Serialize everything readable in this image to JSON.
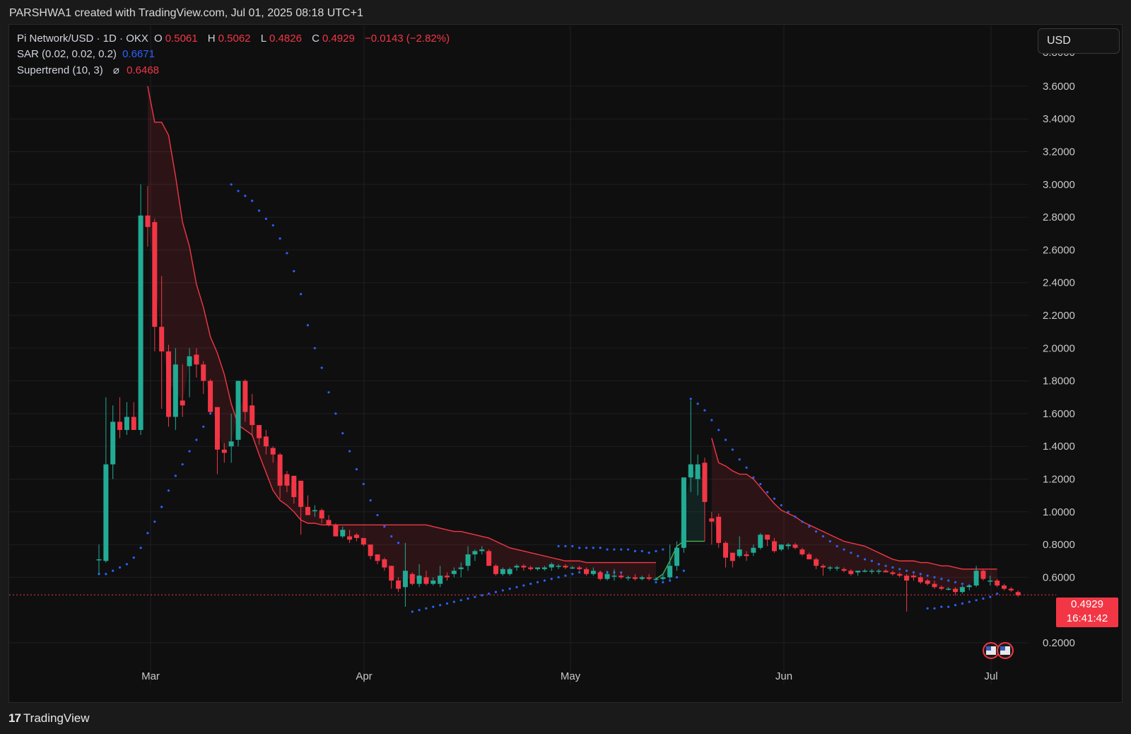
{
  "credit": "PARSHWA1 created with TradingView.com, Jul 01, 2025 08:18 UTC+1",
  "legend": {
    "symbol": "Pi Network/USD · 1D · OKX",
    "o_label": "O",
    "o": "0.5061",
    "h_label": "H",
    "h": "0.5062",
    "l_label": "L",
    "l": "0.4826",
    "c_label": "C",
    "c": "0.4929",
    "change": "−0.0143 (−2.82%)",
    "sar_label": "SAR (0.02, 0.02, 0.2)",
    "sar": "0.6671",
    "st_label": "Supertrend (10, 3)",
    "st_symbol": "⌀",
    "st": "0.6468"
  },
  "currency_button": "USD",
  "last_price": "0.4929",
  "countdown": "16:41:42",
  "footer_brand": "TradingView",
  "footer_logo": "17",
  "colors": {
    "up": "#22ab94",
    "down": "#f23645",
    "sar": "#2962ff",
    "bg": "#0f0f10"
  },
  "chart_data": {
    "type": "candlestick",
    "y_ticks": [
      "0.2000",
      "0.6000",
      "0.8000",
      "1.0000",
      "1.2000",
      "1.4000",
      "1.6000",
      "1.8000",
      "2.0000",
      "2.2000",
      "2.4000",
      "2.6000",
      "2.8000",
      "3.0000",
      "3.2000",
      "3.4000",
      "3.6000"
    ],
    "x_ticks": [
      "Mar",
      "Apr",
      "May",
      "Jun",
      "Jul"
    ],
    "ylim": [
      0.14,
      3.83
    ],
    "x_start": "2025-02-20",
    "candles": [
      [
        0.71,
        0.8,
        0.62,
        0.71
      ],
      [
        0.7,
        1.7,
        0.69,
        1.29
      ],
      [
        1.29,
        1.65,
        1.2,
        1.55
      ],
      [
        1.55,
        1.7,
        1.45,
        1.5
      ],
      [
        1.5,
        1.67,
        1.47,
        1.58
      ],
      [
        1.58,
        1.67,
        1.5,
        1.5
      ],
      [
        1.5,
        3.0,
        1.47,
        2.81
      ],
      [
        2.81,
        2.99,
        2.62,
        2.74
      ],
      [
        2.77,
        2.79,
        1.98,
        2.13
      ],
      [
        2.13,
        2.44,
        1.63,
        1.98
      ],
      [
        1.98,
        2.02,
        1.52,
        1.58
      ],
      [
        1.58,
        2.0,
        1.5,
        1.9
      ],
      [
        1.68,
        1.9,
        1.58,
        1.65
      ],
      [
        1.89,
        2.0,
        1.7,
        1.95
      ],
      [
        1.96,
        2.0,
        1.82,
        1.9
      ],
      [
        1.9,
        1.92,
        1.72,
        1.8
      ],
      [
        1.8,
        1.81,
        1.6,
        1.61
      ],
      [
        1.64,
        1.64,
        1.23,
        1.38
      ],
      [
        1.38,
        1.42,
        1.3,
        1.36
      ],
      [
        1.4,
        1.6,
        1.3,
        1.43
      ],
      [
        1.44,
        1.8,
        1.4,
        1.8
      ],
      [
        1.8,
        1.81,
        1.55,
        1.61
      ],
      [
        1.65,
        1.72,
        1.46,
        1.53
      ],
      [
        1.53,
        1.53,
        1.41,
        1.45
      ],
      [
        1.46,
        1.5,
        1.35,
        1.4
      ],
      [
        1.39,
        1.4,
        1.3,
        1.35
      ],
      [
        1.35,
        1.36,
        1.08,
        1.16
      ],
      [
        1.23,
        1.25,
        1.12,
        1.16
      ],
      [
        1.22,
        1.22,
        1.05,
        1.09
      ],
      [
        1.19,
        1.19,
        0.86,
        1.03
      ],
      [
        1.03,
        1.1,
        0.98,
        0.98
      ],
      [
        1.01,
        1.04,
        0.97,
        1.01
      ],
      [
        1.01,
        1.02,
        0.93,
        0.96
      ],
      [
        0.95,
        0.98,
        0.91,
        0.92
      ],
      [
        0.92,
        0.93,
        0.85,
        0.85
      ],
      [
        0.85,
        0.91,
        0.84,
        0.89
      ],
      [
        0.85,
        0.89,
        0.81,
        0.83
      ],
      [
        0.86,
        0.87,
        0.82,
        0.84
      ],
      [
        0.84,
        0.84,
        0.79,
        0.8
      ],
      [
        0.8,
        0.8,
        0.71,
        0.73
      ],
      [
        0.74,
        0.74,
        0.68,
        0.7
      ],
      [
        0.71,
        0.72,
        0.64,
        0.66
      ],
      [
        0.67,
        0.67,
        0.53,
        0.58
      ],
      [
        0.58,
        0.6,
        0.51,
        0.53
      ],
      [
        0.54,
        0.81,
        0.42,
        0.64
      ],
      [
        0.62,
        0.63,
        0.55,
        0.56
      ],
      [
        0.56,
        0.68,
        0.54,
        0.61
      ],
      [
        0.6,
        0.64,
        0.55,
        0.56
      ],
      [
        0.56,
        0.6,
        0.55,
        0.58
      ],
      [
        0.56,
        0.67,
        0.54,
        0.61
      ],
      [
        0.61,
        0.63,
        0.58,
        0.6
      ],
      [
        0.62,
        0.66,
        0.6,
        0.64
      ],
      [
        0.65,
        0.69,
        0.6,
        0.66
      ],
      [
        0.67,
        0.79,
        0.64,
        0.74
      ],
      [
        0.74,
        0.77,
        0.7,
        0.76
      ],
      [
        0.76,
        0.79,
        0.74,
        0.77
      ],
      [
        0.76,
        0.77,
        0.67,
        0.67
      ],
      [
        0.67,
        0.68,
        0.61,
        0.62
      ],
      [
        0.62,
        0.66,
        0.61,
        0.65
      ],
      [
        0.62,
        0.66,
        0.61,
        0.65
      ],
      [
        0.66,
        0.68,
        0.64,
        0.67
      ],
      [
        0.67,
        0.68,
        0.64,
        0.66
      ],
      [
        0.66,
        0.67,
        0.64,
        0.65
      ],
      [
        0.65,
        0.66,
        0.64,
        0.66
      ],
      [
        0.65,
        0.67,
        0.64,
        0.66
      ],
      [
        0.66,
        0.69,
        0.64,
        0.68
      ],
      [
        0.67,
        0.68,
        0.65,
        0.67
      ],
      [
        0.67,
        0.68,
        0.65,
        0.66
      ],
      [
        0.66,
        0.67,
        0.65,
        0.66
      ],
      [
        0.66,
        0.67,
        0.64,
        0.65
      ],
      [
        0.65,
        0.66,
        0.61,
        0.62
      ],
      [
        0.62,
        0.66,
        0.61,
        0.64
      ],
      [
        0.63,
        0.64,
        0.58,
        0.59
      ],
      [
        0.59,
        0.64,
        0.58,
        0.62
      ],
      [
        0.61,
        0.65,
        0.58,
        0.61
      ],
      [
        0.61,
        0.63,
        0.59,
        0.6
      ],
      [
        0.6,
        0.61,
        0.58,
        0.6
      ],
      [
        0.6,
        0.62,
        0.58,
        0.59
      ],
      [
        0.59,
        0.61,
        0.58,
        0.6
      ],
      [
        0.6,
        0.62,
        0.58,
        0.59
      ],
      [
        0.59,
        0.6,
        0.58,
        0.59
      ],
      [
        0.59,
        0.62,
        0.58,
        0.6
      ],
      [
        0.6,
        0.8,
        0.59,
        0.67
      ],
      [
        0.67,
        0.82,
        0.64,
        0.78
      ],
      [
        0.78,
        1.19,
        0.75,
        1.21
      ],
      [
        1.21,
        1.68,
        1.12,
        1.29
      ],
      [
        1.2,
        1.35,
        1.1,
        1.29
      ],
      [
        1.3,
        1.33,
        0.82,
        1.06
      ],
      [
        0.96,
        1.0,
        0.8,
        0.94
      ],
      [
        0.97,
        0.99,
        0.78,
        0.81
      ],
      [
        0.81,
        0.82,
        0.66,
        0.72
      ],
      [
        0.75,
        0.75,
        0.66,
        0.7
      ],
      [
        0.73,
        0.85,
        0.72,
        0.77
      ],
      [
        0.74,
        0.76,
        0.7,
        0.73
      ],
      [
        0.75,
        0.8,
        0.73,
        0.78
      ],
      [
        0.78,
        0.87,
        0.77,
        0.86
      ],
      [
        0.86,
        0.86,
        0.79,
        0.83
      ],
      [
        0.82,
        0.84,
        0.75,
        0.76
      ],
      [
        0.77,
        0.8,
        0.76,
        0.8
      ],
      [
        0.79,
        0.81,
        0.77,
        0.8
      ],
      [
        0.8,
        0.81,
        0.77,
        0.78
      ],
      [
        0.77,
        0.78,
        0.73,
        0.74
      ],
      [
        0.74,
        0.75,
        0.71,
        0.71
      ],
      [
        0.71,
        0.72,
        0.65,
        0.67
      ],
      [
        0.67,
        0.68,
        0.61,
        0.66
      ],
      [
        0.66,
        0.67,
        0.64,
        0.66
      ],
      [
        0.66,
        0.67,
        0.64,
        0.66
      ],
      [
        0.65,
        0.66,
        0.63,
        0.64
      ],
      [
        0.64,
        0.65,
        0.61,
        0.62
      ],
      [
        0.63,
        0.64,
        0.61,
        0.64
      ],
      [
        0.64,
        0.65,
        0.63,
        0.64
      ],
      [
        0.64,
        0.65,
        0.62,
        0.64
      ],
      [
        0.64,
        0.65,
        0.62,
        0.64
      ],
      [
        0.64,
        0.65,
        0.63,
        0.63
      ],
      [
        0.63,
        0.64,
        0.61,
        0.62
      ],
      [
        0.62,
        0.63,
        0.6,
        0.61
      ],
      [
        0.61,
        0.62,
        0.39,
        0.58
      ],
      [
        0.61,
        0.62,
        0.58,
        0.6
      ],
      [
        0.6,
        0.61,
        0.56,
        0.57
      ],
      [
        0.58,
        0.59,
        0.55,
        0.56
      ],
      [
        0.56,
        0.58,
        0.53,
        0.54
      ],
      [
        0.54,
        0.55,
        0.52,
        0.53
      ],
      [
        0.53,
        0.54,
        0.52,
        0.53
      ],
      [
        0.53,
        0.54,
        0.49,
        0.51
      ],
      [
        0.51,
        0.55,
        0.5,
        0.54
      ],
      [
        0.54,
        0.55,
        0.52,
        0.55
      ],
      [
        0.55,
        0.67,
        0.54,
        0.64
      ],
      [
        0.64,
        0.65,
        0.58,
        0.59
      ],
      [
        0.58,
        0.61,
        0.55,
        0.58
      ],
      [
        0.58,
        0.59,
        0.54,
        0.55
      ],
      [
        0.55,
        0.56,
        0.52,
        0.53
      ],
      [
        0.53,
        0.54,
        0.51,
        0.52
      ],
      [
        0.51,
        0.52,
        0.48,
        0.49
      ]
    ],
    "sar": [
      {
        "x": [
          0,
          1,
          2,
          3,
          4,
          5,
          6
        ],
        "y": [
          0.62,
          0.62,
          0.64,
          0.66,
          0.68,
          0.72,
          0.78
        ]
      },
      {
        "x": [
          7,
          8,
          9,
          10,
          11,
          12,
          13,
          14,
          15,
          16
        ],
        "y": [
          0.87,
          0.94,
          1.03,
          1.13,
          1.22,
          1.29,
          1.37,
          1.44,
          1.52,
          1.6
        ]
      },
      {
        "x": [
          19,
          20,
          21,
          22,
          23,
          24,
          25,
          26,
          27,
          28,
          29,
          30,
          31,
          32,
          33,
          34,
          35,
          36,
          37,
          38,
          39,
          40,
          41,
          42,
          43
        ],
        "y": [
          3.0,
          2.96,
          2.93,
          2.9,
          2.84,
          2.79,
          2.75,
          2.67,
          2.58,
          2.47,
          2.33,
          2.14,
          2.0,
          1.88,
          1.73,
          1.6,
          1.48,
          1.37,
          1.26,
          1.17,
          1.07,
          0.98,
          0.91,
          0.85,
          0.81
        ]
      },
      {
        "x": [
          45,
          46,
          47,
          48,
          49,
          50,
          51,
          52,
          53,
          54,
          55,
          56,
          57,
          58,
          59,
          60,
          61,
          62,
          63,
          64,
          65,
          66,
          67,
          68,
          69,
          70,
          71,
          72,
          73,
          74,
          75
        ],
        "y": [
          0.39,
          0.4,
          0.41,
          0.42,
          0.43,
          0.44,
          0.45,
          0.46,
          0.47,
          0.48,
          0.49,
          0.5,
          0.51,
          0.52,
          0.53,
          0.54,
          0.55,
          0.56,
          0.57,
          0.58,
          0.59,
          0.6,
          0.61,
          0.62,
          0.63,
          0.63,
          0.63,
          0.63,
          0.63,
          0.63,
          0.63
        ]
      },
      {
        "x": [
          66,
          67,
          68,
          69,
          70,
          71,
          72,
          73,
          74,
          75,
          76,
          77,
          78,
          79,
          80,
          81
        ],
        "y": [
          0.79,
          0.79,
          0.79,
          0.78,
          0.78,
          0.78,
          0.78,
          0.77,
          0.77,
          0.77,
          0.77,
          0.76,
          0.76,
          0.75,
          0.76,
          0.77
        ]
      },
      {
        "x": [
          80,
          81,
          82,
          83,
          84
        ],
        "y": [
          0.57,
          0.57,
          0.58,
          0.6,
          0.64
        ]
      },
      {
        "x": [
          85,
          86,
          87,
          88,
          89,
          90,
          91,
          92,
          93,
          94,
          95,
          96,
          97,
          98,
          99,
          100,
          101,
          102,
          103,
          104,
          105,
          106,
          107,
          108,
          109,
          110,
          111,
          112,
          113,
          114,
          115,
          116,
          117,
          118,
          119,
          120,
          121,
          122,
          123,
          124,
          125
        ],
        "y": [
          1.69,
          1.66,
          1.62,
          1.56,
          1.5,
          1.44,
          1.38,
          1.32,
          1.27,
          1.21,
          1.17,
          1.12,
          1.08,
          1.04,
          1.0,
          0.97,
          0.94,
          0.91,
          0.88,
          0.85,
          0.82,
          0.79,
          0.77,
          0.75,
          0.73,
          0.71,
          0.7,
          0.68,
          0.67,
          0.66,
          0.65,
          0.64,
          0.63,
          0.62,
          0.61,
          0.6,
          0.59,
          0.58,
          0.57,
          0.56,
          0.55
        ]
      },
      {
        "x": [
          119,
          120,
          121,
          122,
          123,
          124,
          125,
          126,
          127,
          128,
          129
        ],
        "y": [
          0.41,
          0.41,
          0.42,
          0.42,
          0.43,
          0.44,
          0.45,
          0.46,
          0.47,
          0.48,
          0.5
        ]
      }
    ],
    "supertrend_down": [
      {
        "x": [
          7,
          8,
          9,
          10,
          11,
          12,
          13,
          14,
          15,
          16,
          17,
          18,
          19,
          20,
          21,
          22,
          23,
          24,
          25,
          26,
          27,
          28,
          29,
          30,
          31,
          32,
          33,
          34,
          35,
          36,
          37,
          38,
          39,
          40,
          41,
          42,
          43,
          44,
          45,
          46,
          47,
          48,
          49,
          50,
          51,
          52,
          53,
          54,
          55,
          56,
          57,
          58,
          59,
          60,
          61,
          62,
          63,
          64,
          65,
          66,
          67,
          68,
          69,
          70,
          71,
          72,
          73,
          74,
          75,
          76,
          77,
          78,
          79,
          80
        ],
        "y": [
          3.6,
          3.38,
          3.38,
          3.3,
          3.05,
          2.77,
          2.62,
          2.39,
          2.25,
          2.07,
          1.97,
          1.84,
          1.66,
          1.53,
          1.5,
          1.47,
          1.35,
          1.24,
          1.13,
          1.07,
          1.04,
          1.0,
          0.95,
          0.93,
          0.93,
          0.92,
          0.92,
          0.92,
          0.92,
          0.92,
          0.92,
          0.92,
          0.92,
          0.92,
          0.92,
          0.92,
          0.92,
          0.92,
          0.92,
          0.92,
          0.92,
          0.91,
          0.9,
          0.89,
          0.88,
          0.88,
          0.87,
          0.86,
          0.85,
          0.84,
          0.82,
          0.8,
          0.78,
          0.77,
          0.76,
          0.75,
          0.74,
          0.73,
          0.72,
          0.71,
          0.7,
          0.7,
          0.7,
          0.69,
          0.69,
          0.69,
          0.69,
          0.69,
          0.69,
          0.69,
          0.69,
          0.69,
          0.69,
          0.69
        ]
      },
      {
        "x": [
          88,
          89,
          90,
          91,
          92,
          93,
          94,
          95,
          96,
          97,
          98,
          99,
          100,
          101,
          102,
          103,
          104,
          105,
          106,
          107,
          108,
          109,
          110,
          111,
          112,
          113,
          114,
          115,
          116,
          117,
          118,
          119,
          120,
          121,
          122,
          123,
          124,
          125,
          126,
          127,
          128,
          129
        ],
        "y": [
          1.45,
          1.3,
          1.28,
          1.25,
          1.23,
          1.23,
          1.2,
          1.15,
          1.1,
          1.05,
          1.01,
          0.99,
          0.97,
          0.94,
          0.92,
          0.9,
          0.88,
          0.86,
          0.84,
          0.82,
          0.81,
          0.8,
          0.79,
          0.77,
          0.75,
          0.73,
          0.71,
          0.7,
          0.7,
          0.7,
          0.69,
          0.69,
          0.68,
          0.67,
          0.67,
          0.66,
          0.65,
          0.65,
          0.65,
          0.65,
          0.65,
          0.65
        ]
      }
    ],
    "supertrend_up": [
      {
        "x": [
          80,
          81,
          82,
          83,
          84,
          85,
          86,
          87
        ],
        "y": [
          0.59,
          0.62,
          0.7,
          0.79,
          0.82,
          0.82,
          0.82,
          0.82
        ]
      }
    ]
  }
}
